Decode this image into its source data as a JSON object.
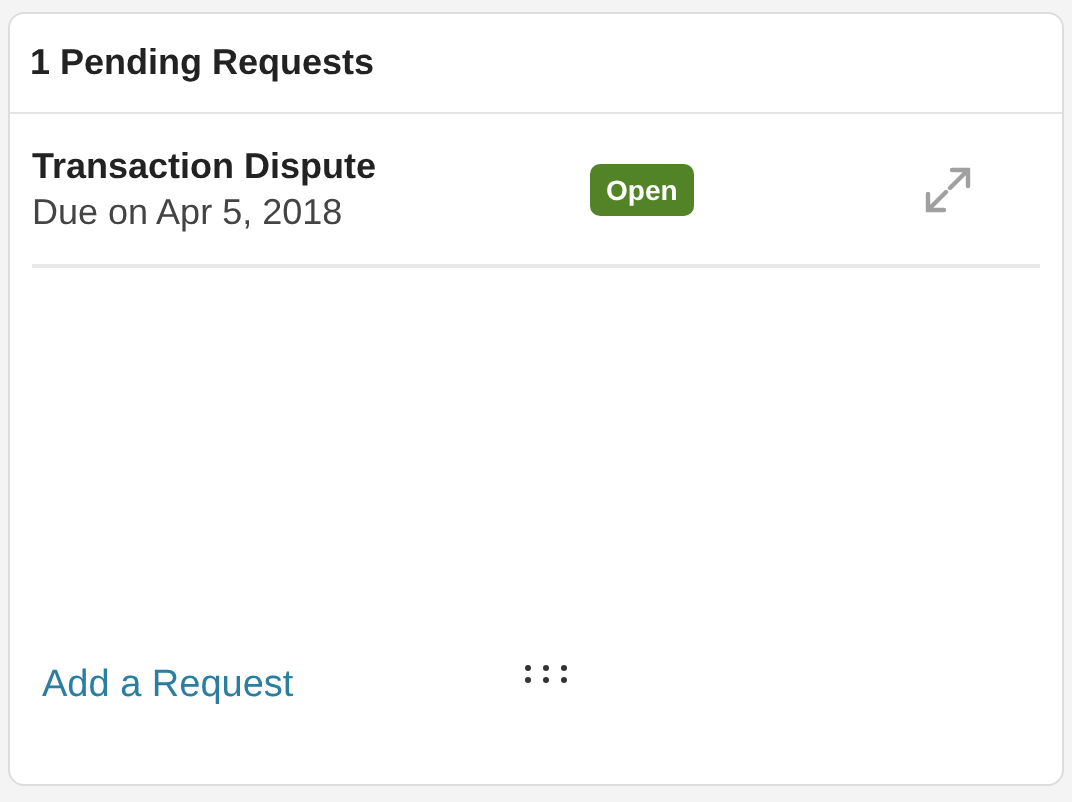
{
  "card": {
    "title": "1 Pending Requests",
    "requests": [
      {
        "title": "Transaction Dispute",
        "due": "Due on Apr 5, 2018",
        "status": {
          "label": "Open",
          "kind": "open"
        }
      }
    ],
    "footer": {
      "link": "Add a Request"
    }
  }
}
